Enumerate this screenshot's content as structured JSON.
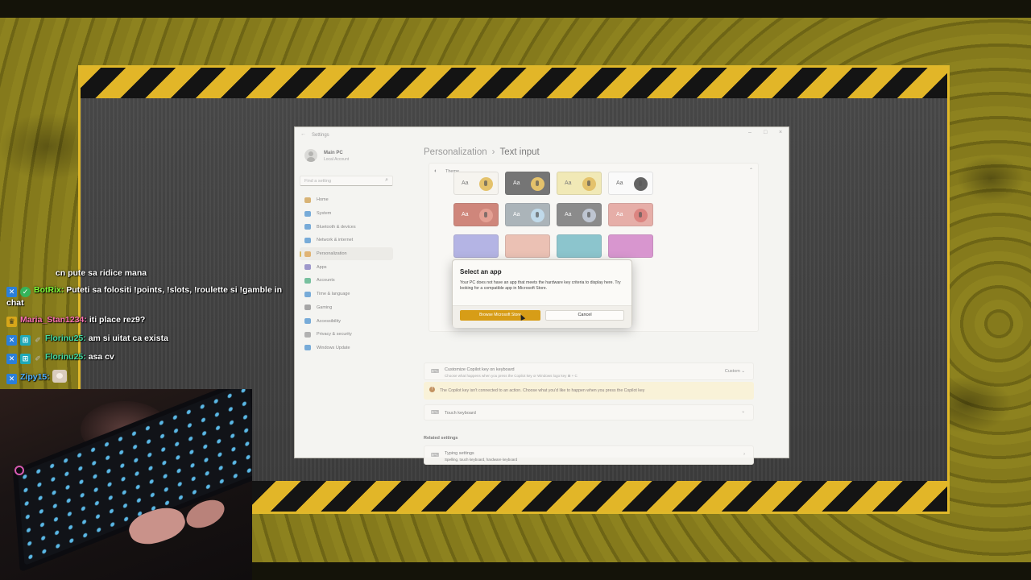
{
  "window": {
    "title": "Settings",
    "controls": {
      "minimize": "–",
      "maximize": "□",
      "close": "×"
    }
  },
  "user": {
    "name": "Main PC",
    "account_type": "Local Account"
  },
  "search": {
    "placeholder": "Find a setting"
  },
  "sidebar": {
    "items": [
      {
        "label": "Home",
        "icon": "home-icon",
        "color": "#c48a2b"
      },
      {
        "label": "System",
        "icon": "system-icon",
        "color": "#2f7fc4"
      },
      {
        "label": "Bluetooth & devices",
        "icon": "bluetooth-icon",
        "color": "#2f7fc4"
      },
      {
        "label": "Network & internet",
        "icon": "network-icon",
        "color": "#2f7fc4"
      },
      {
        "label": "Personalization",
        "icon": "brush-icon",
        "color": "#d08a2a",
        "active": true
      },
      {
        "label": "Apps",
        "icon": "apps-icon",
        "color": "#6a62b0"
      },
      {
        "label": "Accounts",
        "icon": "accounts-icon",
        "color": "#2f9e6a"
      },
      {
        "label": "Time & language",
        "icon": "time-icon",
        "color": "#2f7fc4"
      },
      {
        "label": "Gaming",
        "icon": "gaming-icon",
        "color": "#777777"
      },
      {
        "label": "Accessibility",
        "icon": "accessibility-icon",
        "color": "#2f7fc4"
      },
      {
        "label": "Privacy & security",
        "icon": "shield-icon",
        "color": "#888888"
      },
      {
        "label": "Windows Update",
        "icon": "update-icon",
        "color": "#2f7fc4"
      }
    ]
  },
  "breadcrumb": {
    "parent": "Personalization",
    "separator": "›",
    "current": "Text input"
  },
  "theme": {
    "label": "Theme",
    "tiles": [
      {
        "aa": "Aa",
        "bg": "#f2efe6",
        "fg": "#333",
        "mic": "#d6a11d"
      },
      {
        "aa": "Aa",
        "bg": "#2c2c2c",
        "fg": "#eee",
        "mic": "#d6a11d"
      },
      {
        "aa": "Aa",
        "bg": "#eadd8f",
        "fg": "#333",
        "mic": "#d6a11d"
      },
      {
        "aa": "Aa",
        "bg": "#f7f7f7",
        "fg": "#222",
        "mic": "#111111"
      },
      {
        "aa": "Aa",
        "bg": "#b64635",
        "fg": "#fff",
        "mic": "#d66e5a"
      },
      {
        "aa": "Aa",
        "bg": "#7f8c94",
        "fg": "#fff",
        "mic": "#9fc7df"
      },
      {
        "aa": "Aa",
        "bg": "#4e4e4e",
        "fg": "#eee",
        "mic": "#9ba7b8"
      },
      {
        "aa": "Aa",
        "bg": "#d9837a",
        "fg": "#fff",
        "mic": "#c9433c"
      }
    ]
  },
  "copilot_row": {
    "title": "Customize Copilot key on keyboard",
    "subtitle": "Choose what happens when you press the Copilot key or Windows logo key ⊞ + C",
    "value": "Custom"
  },
  "warning": {
    "text": "The Copilot key isn't connected to an action. Choose what you'd like to happen when you press the Copilot key"
  },
  "touch_row": {
    "title": "Touch keyboard"
  },
  "related": {
    "heading": "Related settings",
    "title": "Typing settings",
    "subtitle": "Spelling, touch keyboard, hardware keyboard"
  },
  "dialog": {
    "title": "Select an app",
    "body": "Your PC does not have an app that meets the hardware key criteria to display here. Try looking for a compatible app in Microsoft Store.",
    "primary": "Browse Microsoft Store",
    "cancel": "Cancel"
  },
  "chat": [
    {
      "badges": [],
      "user": "",
      "user_color": "#ff3b3b",
      "text": "cn pute sa ridice mana"
    },
    {
      "badges": [
        "blue",
        "green"
      ],
      "user": "BotRix:",
      "user_color": "#7dff3a",
      "text": "Puteti sa folositi !points, !slots, !roulette si !gamble in chat"
    },
    {
      "badges": [
        "gold"
      ],
      "user": "Maria_Stan1234:",
      "user_color": "#ff73b4",
      "text": "iti place rez9?"
    },
    {
      "badges": [
        "blue",
        "cyan",
        "gray"
      ],
      "user": "Florinu25:",
      "user_color": "#43d9a2",
      "text": "am si uitat ca exista"
    },
    {
      "badges": [
        "blue",
        "cyan",
        "gray"
      ],
      "user": "Florinu25:",
      "user_color": "#43d9a2",
      "text": "asa cv"
    },
    {
      "badges": [
        "blue"
      ],
      "user": "Zipy15:",
      "user_color": "#4fb2ff",
      "text": ""
    }
  ]
}
